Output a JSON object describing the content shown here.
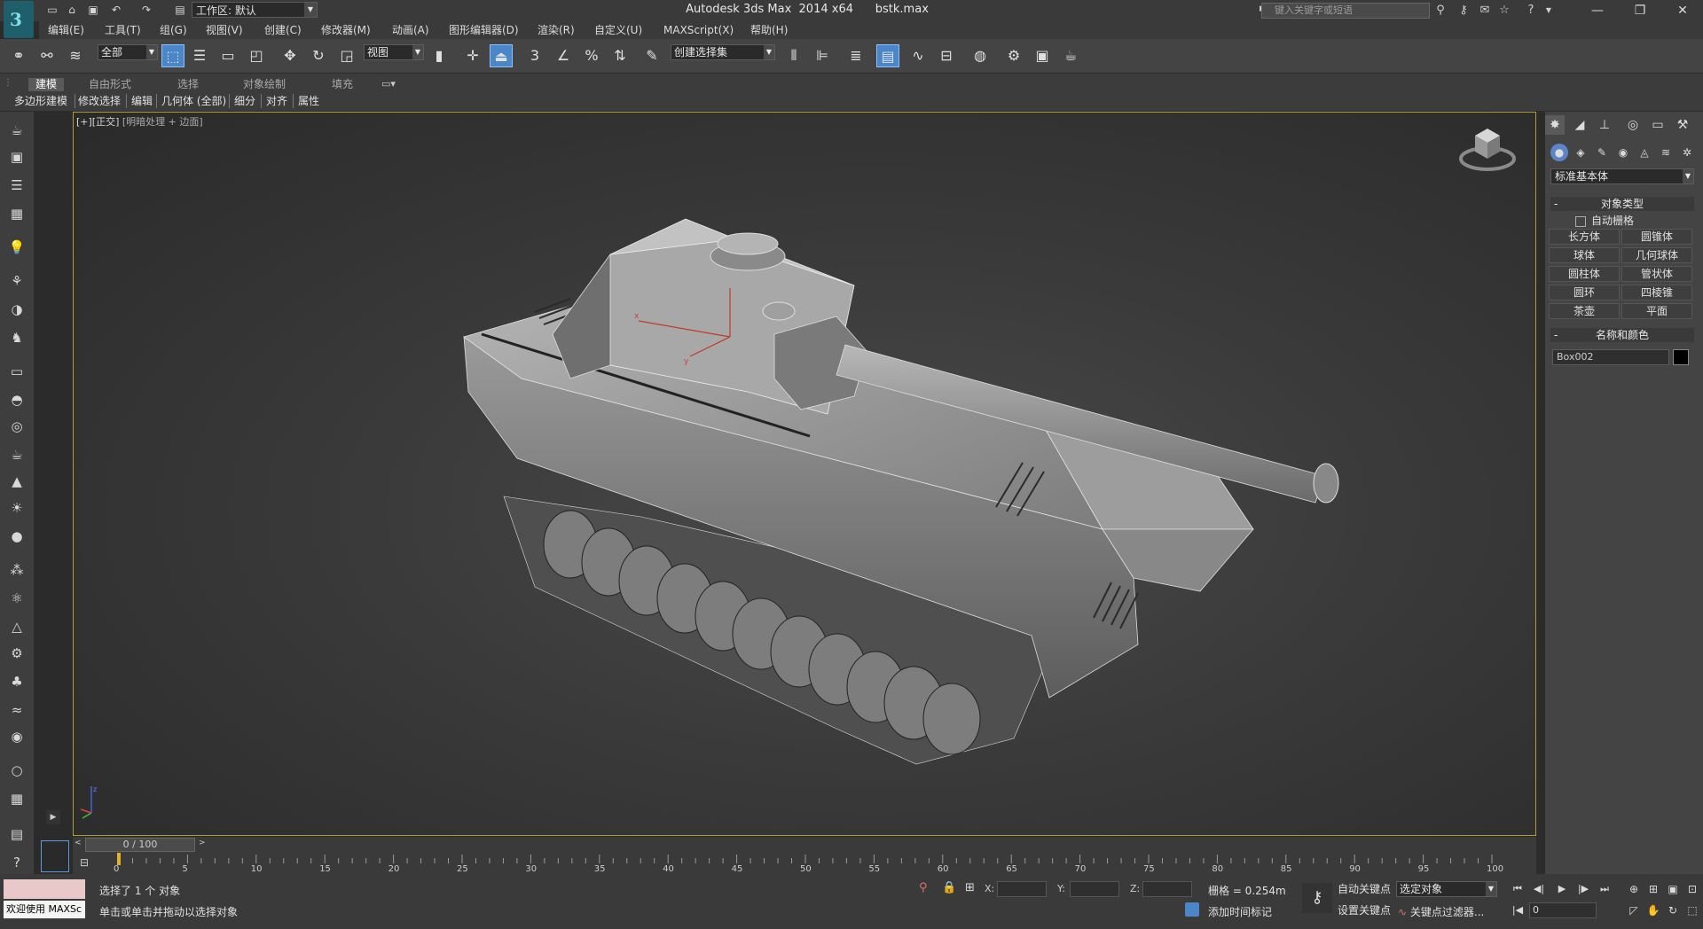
{
  "titlebar": {
    "title": "Autodesk 3ds Max  2014 x64      bstk.max",
    "workspace": "工作区: 默认",
    "search_placeholder": "键入关键字或短语"
  },
  "menu": [
    "编辑(E)",
    "工具(T)",
    "组(G)",
    "视图(V)",
    "创建(C)",
    "修改器(M)",
    "动画(A)",
    "图形编辑器(D)",
    "渲染(R)",
    "自定义(U)",
    "MAXScript(X)",
    "帮助(H)"
  ],
  "toolbar": {
    "selection_filter": "全部",
    "reference_coord": "视图",
    "snap_label": "3",
    "named_selection": "创建选择集"
  },
  "ribbon": {
    "tabs": [
      "建模",
      "自由形式",
      "选择",
      "对象绘制",
      "填充"
    ],
    "subtabs": [
      "多边形建模",
      "修改选择",
      "编辑",
      "几何体 (全部)",
      "细分",
      "对齐",
      "属性"
    ]
  },
  "viewport": {
    "label_main": "[+][正交]",
    "label_sub": "[明暗处理 + 边面]",
    "axis_x": "x",
    "axis_y": "y",
    "axis_z": "z"
  },
  "command_panel": {
    "category": "标准基本体",
    "object_type_title": "对象类型",
    "autogrid": "自动栅格",
    "primitives": [
      "长方体",
      "圆锥体",
      "球体",
      "几何球体",
      "圆柱体",
      "管状体",
      "圆环",
      "四棱锥",
      "茶壶",
      "平面"
    ],
    "name_color_title": "名称和颜色",
    "object_name": "Box002",
    "object_color": "#000000"
  },
  "timeline": {
    "slider_label": "0 / 100",
    "ticks": [
      "0",
      "5",
      "10",
      "15",
      "20",
      "25",
      "30",
      "35",
      "40",
      "45",
      "50",
      "55",
      "60",
      "65",
      "70",
      "75",
      "80",
      "85",
      "90",
      "95",
      "100"
    ]
  },
  "status": {
    "listener": "欢迎使用 MAXSc",
    "line1": "选择了 1 个 对象",
    "line2": "单击或单击并拖动以选择对象",
    "x_label": "X:",
    "y_label": "Y:",
    "z_label": "Z:",
    "grid": "栅格 = 0.254m",
    "add_time_tag": "添加时间标记",
    "auto_key": "自动关键点",
    "set_key": "设置关键点",
    "key_mode": "选定对象",
    "key_filters": "关键点过滤器...",
    "frame": "0"
  }
}
